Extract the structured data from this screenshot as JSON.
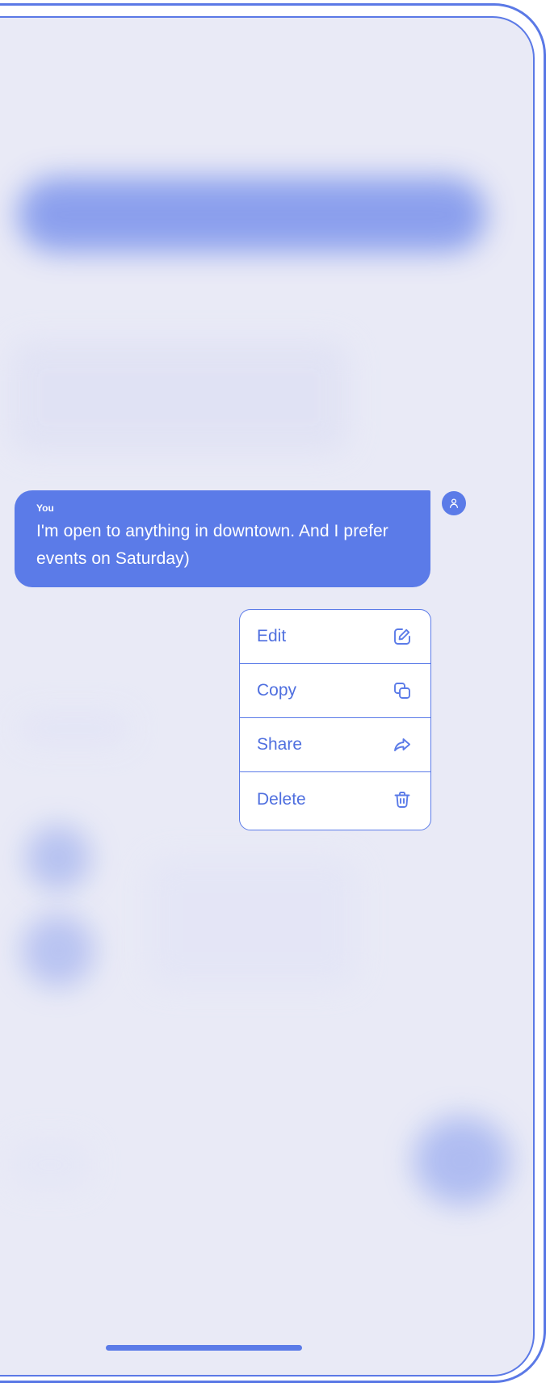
{
  "message": {
    "sender": "You",
    "text": "I'm open to anything in downtown. And I prefer events on Saturday)",
    "avatar_icon": "user-icon"
  },
  "context_menu": {
    "items": [
      {
        "label": "Edit",
        "icon": "edit-icon"
      },
      {
        "label": "Copy",
        "icon": "copy-icon"
      },
      {
        "label": "Share",
        "icon": "share-icon"
      },
      {
        "label": "Delete",
        "icon": "trash-icon"
      }
    ]
  },
  "colors": {
    "accent": "#5b7be8",
    "screen_background": "#e9eaf6",
    "menu_background": "#ffffff",
    "menu_text": "#4f6fdf"
  }
}
